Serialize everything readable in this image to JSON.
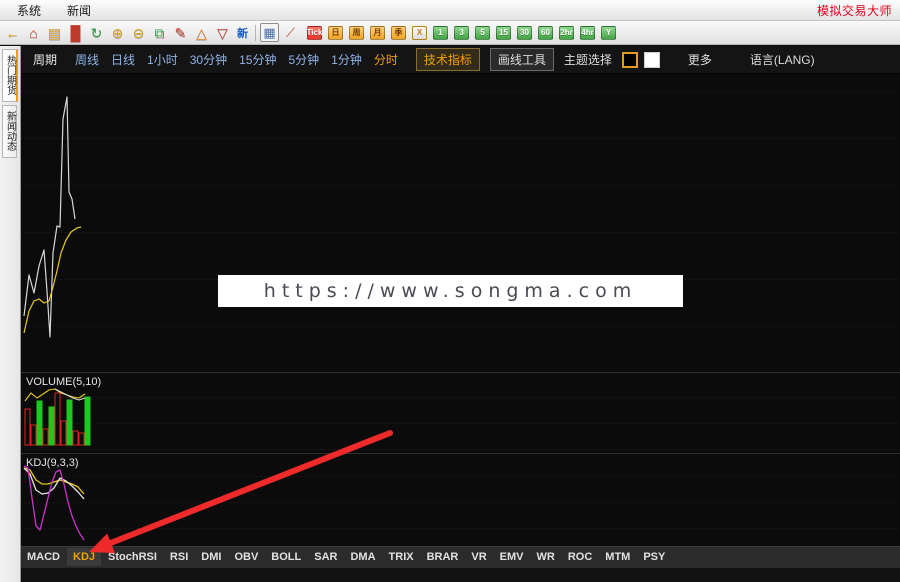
{
  "window": {
    "brand_title": "模拟交易大师",
    "menus": [
      {
        "label": "系统",
        "name": "menu-system"
      },
      {
        "label": "新闻",
        "name": "menu-news"
      }
    ]
  },
  "toolbar": {
    "icons": [
      {
        "name": "back-arrow-icon",
        "glyph": "←",
        "color": "#f0a000"
      },
      {
        "name": "home-icon",
        "glyph": "⌂",
        "color": "#d04020"
      },
      {
        "name": "notes-icon",
        "glyph": "▤",
        "color": "#d89a30"
      },
      {
        "name": "chart-bars-icon",
        "glyph": "█",
        "color": "#c0392b"
      },
      {
        "name": "refresh-icon",
        "glyph": "↻",
        "color": "#2f9e44"
      },
      {
        "name": "zoom-in-icon",
        "glyph": "⊕",
        "color": "#d9a520"
      },
      {
        "name": "zoom-out-icon",
        "glyph": "⊖",
        "color": "#d9a520"
      },
      {
        "name": "copy-icon",
        "glyph": "⧉",
        "color": "#2f9e44"
      },
      {
        "name": "pencil-icon",
        "glyph": "✎",
        "color": "#c0392b"
      },
      {
        "name": "alert-icon",
        "glyph": "△",
        "color": "#e07a1f"
      },
      {
        "name": "filter-icon",
        "glyph": "▽",
        "color": "#c0392b"
      }
    ],
    "new_label": "新",
    "view_icons": [
      {
        "name": "quote-table-icon",
        "glyph": "▦",
        "color": "#4a6fa5",
        "framed": true
      },
      {
        "name": "trend-chart-icon",
        "glyph": "⟋",
        "color": "#c0392b"
      }
    ],
    "period_tags": [
      {
        "name": "tick-button",
        "label": "Tick",
        "style": "red"
      },
      {
        "name": "day-button",
        "label": "日",
        "style": "orange"
      },
      {
        "name": "week-button",
        "label": "周",
        "style": "orange"
      },
      {
        "name": "month-button",
        "label": "月",
        "style": "orange"
      },
      {
        "name": "quarter-button",
        "label": "季",
        "style": "orange"
      },
      {
        "name": "custom-button",
        "label": "X",
        "style": "white"
      },
      {
        "name": "min1-button",
        "label": "1",
        "style": "green"
      },
      {
        "name": "min3-button",
        "label": "3",
        "style": "green"
      },
      {
        "name": "min5-button",
        "label": "5",
        "style": "green"
      },
      {
        "name": "min15-button",
        "label": "15",
        "style": "green"
      },
      {
        "name": "min30-button",
        "label": "30",
        "style": "green"
      },
      {
        "name": "min60-button",
        "label": "60",
        "style": "green"
      },
      {
        "name": "hour2-button",
        "label": "2hr",
        "style": "green"
      },
      {
        "name": "hour4-button",
        "label": "4hr",
        "style": "green"
      },
      {
        "name": "year-button",
        "label": "Y",
        "style": "green"
      }
    ]
  },
  "sidebar": {
    "tabs": [
      {
        "name": "sidebar-tab-hot-futures",
        "label": "热门期货",
        "active": true
      },
      {
        "name": "sidebar-tab-news",
        "label": "新闻动态",
        "active": false
      }
    ]
  },
  "subbar": {
    "period_label": "周期",
    "periods": [
      {
        "name": "period-week",
        "label": "周线",
        "hot": false
      },
      {
        "name": "period-day",
        "label": "日线",
        "hot": false
      },
      {
        "name": "period-1hour",
        "label": "1小时",
        "hot": false
      },
      {
        "name": "period-30min",
        "label": "30分钟",
        "hot": false
      },
      {
        "name": "period-15min",
        "label": "15分钟",
        "hot": false
      },
      {
        "name": "period-5min",
        "label": "5分钟",
        "hot": false
      },
      {
        "name": "period-1min",
        "label": "1分钟",
        "hot": false
      },
      {
        "name": "period-timeshare",
        "label": "分时",
        "hot": true
      }
    ],
    "tech_indicator_label": "技术指标",
    "draw_tools_label": "画线工具",
    "theme_label": "主题选择",
    "more_label": "更多",
    "language_label": "语言(LANG)",
    "theme_selected": "dark"
  },
  "watermark": {
    "text": "https://www.songma.com"
  },
  "panes": {
    "price": {
      "name": "price-pane",
      "title": ""
    },
    "volume": {
      "name": "volume-pane",
      "title": "VOLUME(5,10)"
    },
    "kdj": {
      "name": "kdj-pane",
      "title": "KDJ(9,3,3)"
    }
  },
  "indicators": {
    "items": [
      {
        "name": "indicator-macd",
        "label": "MACD",
        "active": false
      },
      {
        "name": "indicator-kdj",
        "label": "KDJ",
        "active": true
      },
      {
        "name": "indicator-stochrsi",
        "label": "StochRSI",
        "active": false
      },
      {
        "name": "indicator-rsi",
        "label": "RSI",
        "active": false
      },
      {
        "name": "indicator-dmi",
        "label": "DMI",
        "active": false
      },
      {
        "name": "indicator-obv",
        "label": "OBV",
        "active": false
      },
      {
        "name": "indicator-boll",
        "label": "BOLL",
        "active": false
      },
      {
        "name": "indicator-sar",
        "label": "SAR",
        "active": false
      },
      {
        "name": "indicator-dma",
        "label": "DMA",
        "active": false
      },
      {
        "name": "indicator-trix",
        "label": "TRIX",
        "active": false
      },
      {
        "name": "indicator-brar",
        "label": "BRAR",
        "active": false
      },
      {
        "name": "indicator-vr",
        "label": "VR",
        "active": false
      },
      {
        "name": "indicator-emv",
        "label": "EMV",
        "active": false
      },
      {
        "name": "indicator-wr",
        "label": "WR",
        "active": false
      },
      {
        "name": "indicator-roc",
        "label": "ROC",
        "active": false
      },
      {
        "name": "indicator-mtm",
        "label": "MTM",
        "active": false
      },
      {
        "name": "indicator-psy",
        "label": "PSY",
        "active": false
      }
    ]
  },
  "annotation": {
    "name": "red-arrow-annotation",
    "color": "#ee2a2a",
    "from": [
      369,
      387
    ],
    "to": [
      68,
      506
    ]
  },
  "chart_data": {
    "type": "line",
    "title": "",
    "panes": [
      {
        "name": "price",
        "type": "line",
        "grid": true,
        "gridlines_y": [
          47,
          94,
          141,
          188,
          235,
          282
        ],
        "series": [
          {
            "name": "price",
            "color": "#d8d8d8",
            "points": [
              [
                3,
                241
              ],
              [
                8,
                200
              ],
              [
                13,
                218
              ],
              [
                18,
                191
              ],
              [
                23,
                175
              ],
              [
                26,
                216
              ],
              [
                29,
                262
              ],
              [
                32,
                178
              ],
              [
                36,
                151
              ],
              [
                39,
                152
              ],
              [
                42,
                44
              ],
              [
                46,
                22
              ],
              [
                48,
                117
              ],
              [
                51,
                124
              ],
              [
                54,
                144
              ]
            ]
          },
          {
            "name": "ma",
            "color": "#e8c81e",
            "points": [
              [
                3,
                258
              ],
              [
                8,
                236
              ],
              [
                13,
                226
              ],
              [
                18,
                224
              ],
              [
                23,
                228
              ],
              [
                28,
                226
              ],
              [
                32,
                212
              ],
              [
                36,
                196
              ],
              [
                40,
                178
              ],
              [
                45,
                165
              ],
              [
                50,
                157
              ],
              [
                56,
                153
              ],
              [
                60,
                152
              ]
            ]
          }
        ],
        "ylim": [
          0,
          290
        ]
      },
      {
        "name": "volume",
        "type": "bar",
        "title": "VOLUME(5,10)",
        "grid": true,
        "bars": [
          {
            "x": 4,
            "h": 36,
            "style": "hollow-red"
          },
          {
            "x": 10,
            "h": 20,
            "style": "hollow-red"
          },
          {
            "x": 16,
            "h": 44,
            "style": "solid-green"
          },
          {
            "x": 22,
            "h": 16,
            "style": "hollow-red"
          },
          {
            "x": 28,
            "h": 38,
            "style": "solid-green"
          },
          {
            "x": 34,
            "h": 52,
            "style": "hollow-red"
          },
          {
            "x": 40,
            "h": 24,
            "style": "hollow-red"
          },
          {
            "x": 46,
            "h": 45,
            "style": "solid-green"
          },
          {
            "x": 52,
            "h": 14,
            "style": "hollow-red"
          },
          {
            "x": 58,
            "h": 12,
            "style": "hollow-red"
          },
          {
            "x": 64,
            "h": 48,
            "style": "solid-green"
          }
        ],
        "series": [
          {
            "name": "ma5",
            "color": "#e8c81e",
            "points": [
              [
                4,
                28
              ],
              [
                10,
                20
              ],
              [
                16,
                25
              ],
              [
                22,
                21
              ],
              [
                28,
                17
              ],
              [
                34,
                16
              ],
              [
                40,
                20
              ],
              [
                46,
                22
              ],
              [
                52,
                24
              ],
              [
                58,
                25
              ],
              [
                64,
                21
              ]
            ]
          },
          {
            "name": "ma10",
            "color": "#dadada",
            "points": [
              [
                34,
                16
              ],
              [
                40,
                19
              ],
              [
                46,
                22
              ],
              [
                52,
                25
              ],
              [
                58,
                27
              ],
              [
                64,
                25
              ]
            ]
          }
        ]
      },
      {
        "name": "kdj",
        "type": "line",
        "title": "KDJ(9,3,3)",
        "grid": true,
        "series": [
          {
            "name": "K",
            "color": "#e8c81e",
            "points": [
              [
                3,
                14
              ],
              [
                9,
                16
              ],
              [
                15,
                26
              ],
              [
                21,
                30
              ],
              [
                27,
                30
              ],
              [
                33,
                28
              ],
              [
                39,
                26
              ],
              [
                45,
                28
              ],
              [
                51,
                30
              ],
              [
                57,
                33
              ],
              [
                63,
                40
              ]
            ]
          },
          {
            "name": "D",
            "color": "#e4e4e4",
            "points": [
              [
                3,
                14
              ],
              [
                9,
                20
              ],
              [
                15,
                36
              ],
              [
                21,
                40
              ],
              [
                27,
                39
              ],
              [
                33,
                34
              ],
              [
                39,
                24
              ],
              [
                45,
                27
              ],
              [
                51,
                32
              ],
              [
                57,
                38
              ],
              [
                63,
                45
              ]
            ]
          },
          {
            "name": "J",
            "color": "#cc33cc",
            "points": [
              [
                3,
                12
              ],
              [
                7,
                14
              ],
              [
                11,
                44
              ],
              [
                15,
                72
              ],
              [
                19,
                76
              ],
              [
                23,
                60
              ],
              [
                27,
                44
              ],
              [
                31,
                28
              ],
              [
                35,
                18
              ],
              [
                39,
                16
              ],
              [
                43,
                30
              ],
              [
                47,
                48
              ],
              [
                51,
                62
              ],
              [
                55,
                72
              ],
              [
                59,
                80
              ],
              [
                63,
                86
              ]
            ]
          }
        ]
      }
    ]
  }
}
